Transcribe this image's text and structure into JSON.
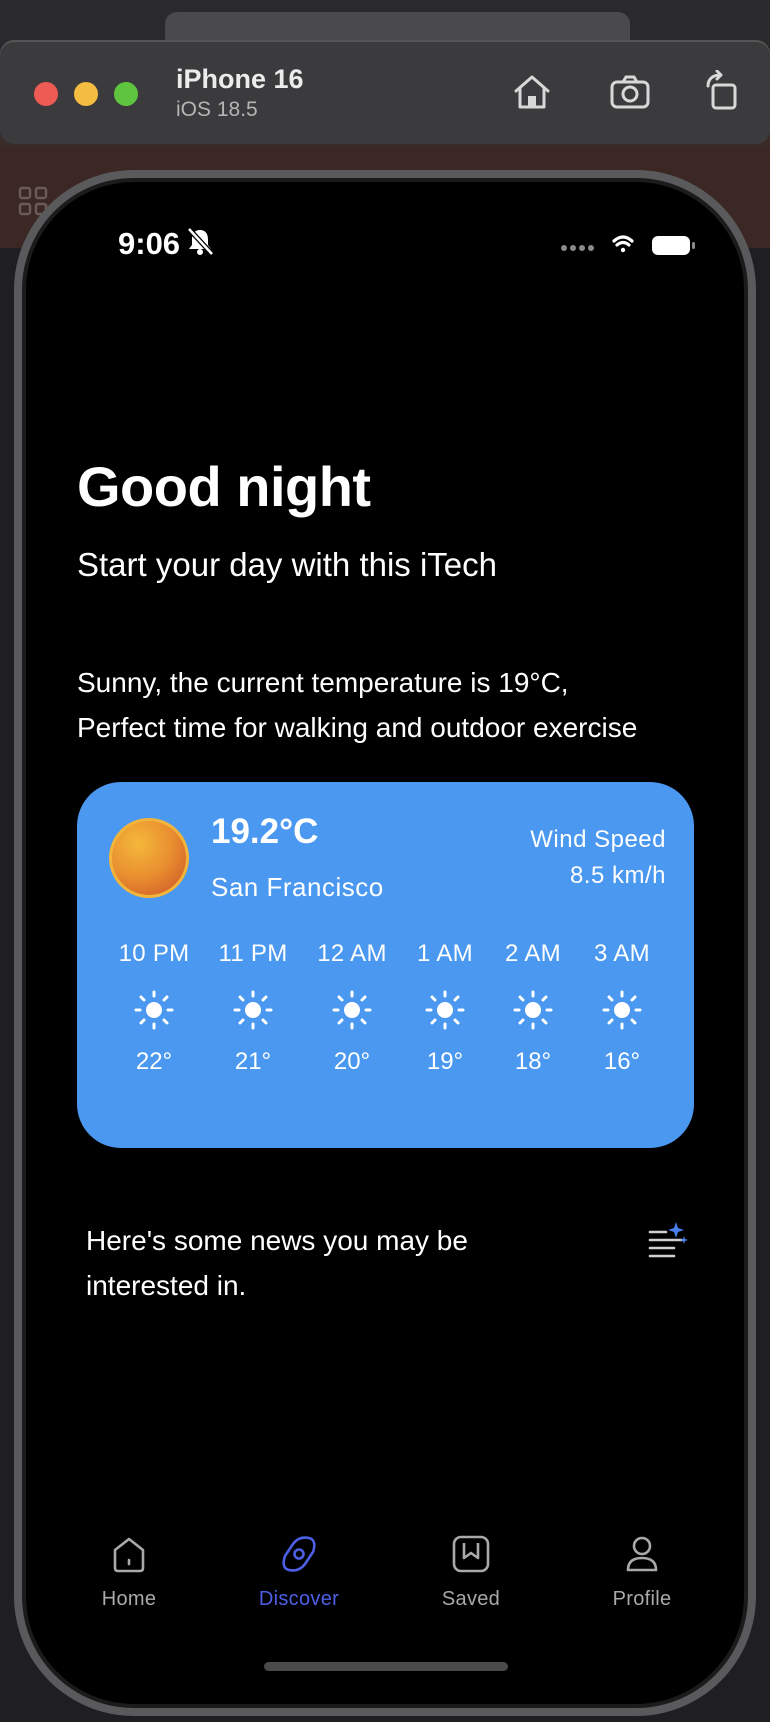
{
  "simulator": {
    "device_name": "iPhone 16",
    "os_version": "iOS 18.5",
    "toolbar_icons": [
      "home-icon",
      "screenshot-icon",
      "rotate-icon"
    ]
  },
  "status_bar": {
    "time": "9:06",
    "icons": [
      "bell-slash-icon",
      "signal-dots-icon",
      "wifi-icon",
      "battery-icon"
    ]
  },
  "greeting": {
    "title": "Good night",
    "subtitle": "Start your day with this iTech"
  },
  "weather_summary": {
    "line1": "Sunny, the current temperature is 19°C,",
    "line2": "Perfect time for walking and outdoor exercise"
  },
  "weather_card": {
    "background_color": "#4a98f0",
    "temperature": "19.2°C",
    "city": "San Francisco",
    "wind_label": "Wind Speed",
    "wind_value": "8.5 km/h",
    "hourly": [
      {
        "time": "10 PM",
        "temp": "22°",
        "icon": "sun-icon"
      },
      {
        "time": "11 PM",
        "temp": "21°",
        "icon": "sun-icon"
      },
      {
        "time": "12 AM",
        "temp": "20°",
        "icon": "sun-icon"
      },
      {
        "time": "1 AM",
        "temp": "19°",
        "icon": "sun-icon"
      },
      {
        "time": "2 AM",
        "temp": "18°",
        "icon": "sun-icon"
      },
      {
        "time": "3 AM",
        "temp": "16°",
        "icon": "sun-icon"
      }
    ]
  },
  "news": {
    "line1": "Here's some news you may be",
    "line2": "interested in.",
    "icon": "ai-sparkle-list-icon"
  },
  "tabbar": {
    "active_color": "#4d5fe6",
    "items": [
      {
        "label": "Home",
        "icon": "home-icon"
      },
      {
        "label": "Discover",
        "icon": "compass-icon"
      },
      {
        "label": "Saved",
        "icon": "bookmark-icon"
      },
      {
        "label": "Profile",
        "icon": "person-icon"
      }
    ]
  }
}
